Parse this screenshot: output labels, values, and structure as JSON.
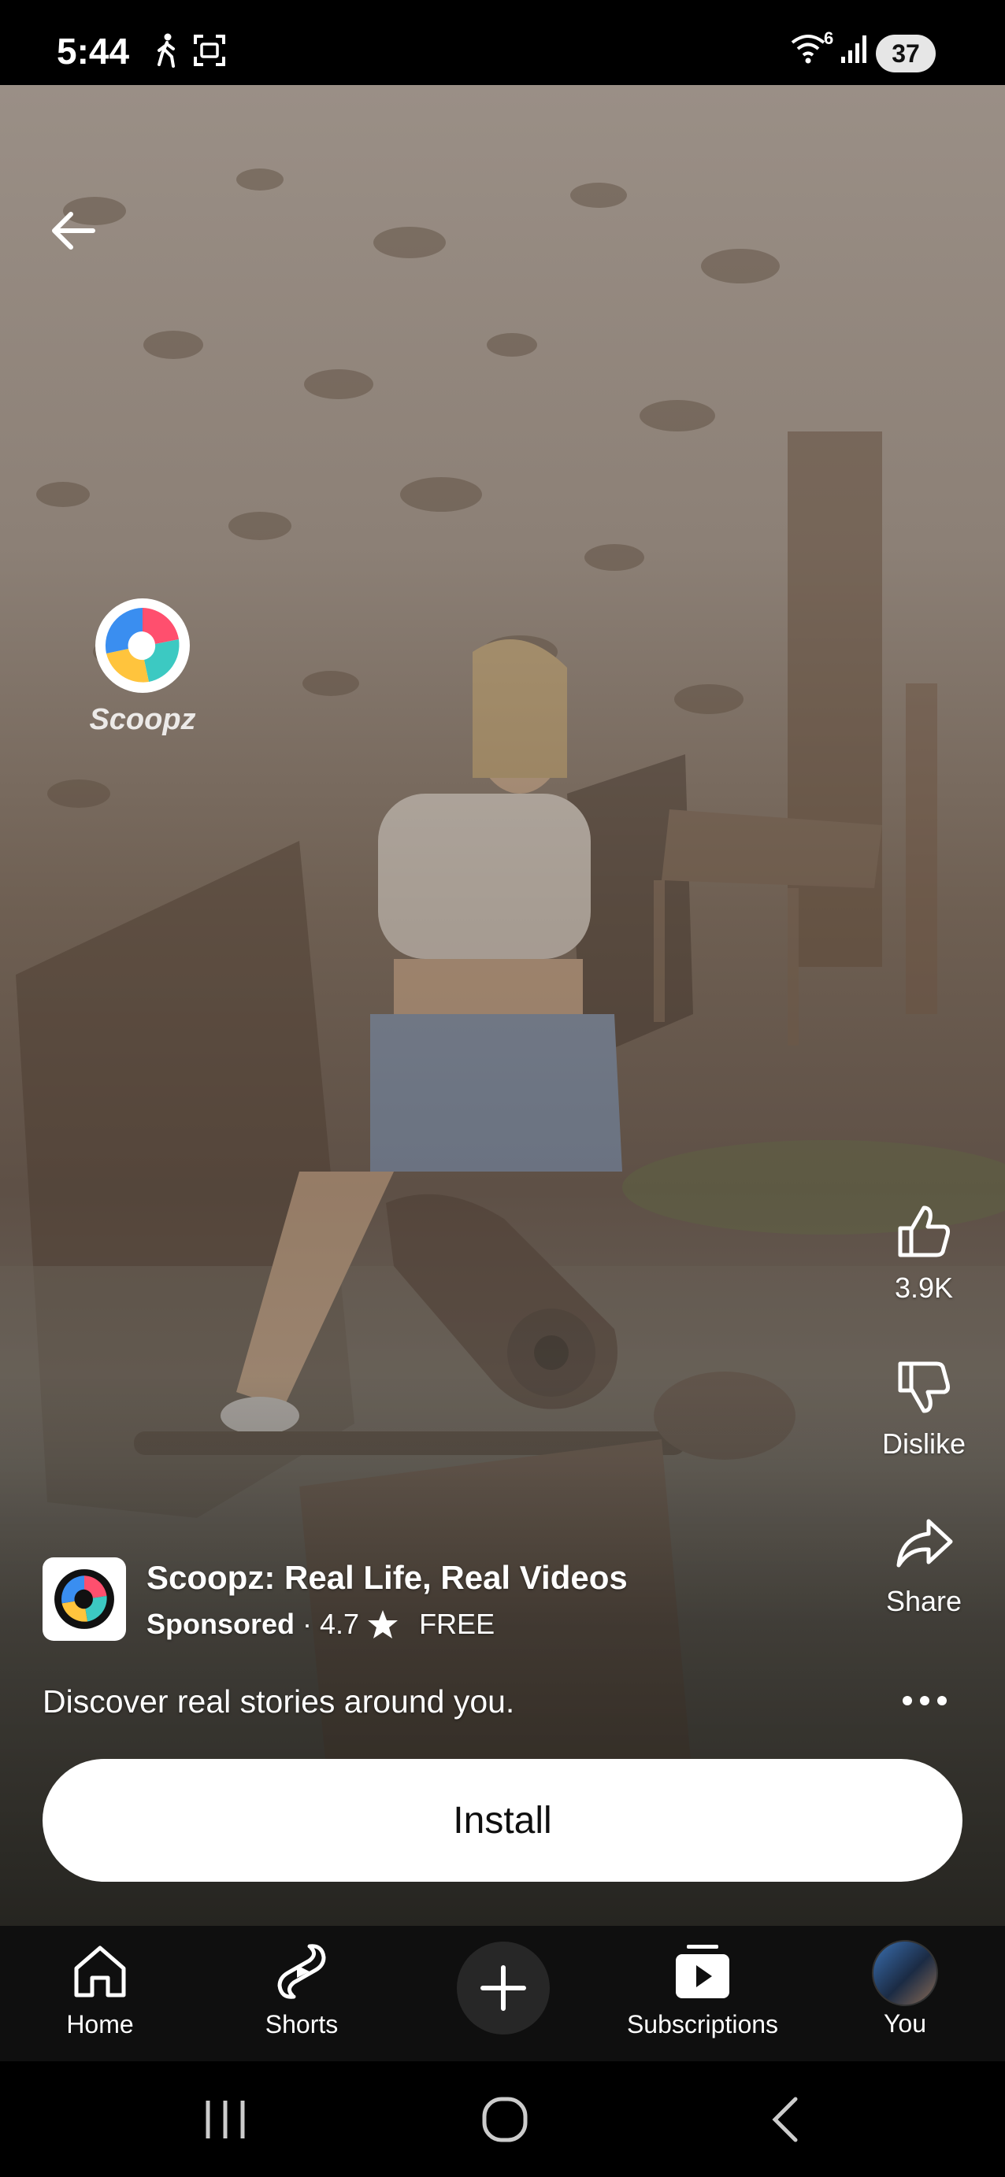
{
  "status_bar": {
    "time": "5:44",
    "icons": [
      "walking-icon",
      "screenshot-icon",
      "wifi-icon",
      "signal-icon"
    ],
    "wifi_badge": "6",
    "battery": "37"
  },
  "video": {
    "watermark_label": "Scoopz"
  },
  "actions": {
    "like_count": "3.9K",
    "dislike_label": "Dislike",
    "share_label": "Share"
  },
  "ad": {
    "title": "Scoopz: Real Life, Real Videos",
    "sponsored": "Sponsored",
    "separator": "·",
    "rating": "4.7",
    "price": "FREE",
    "description": "Discover real stories around you.",
    "install_label": "Install"
  },
  "nav": {
    "home": "Home",
    "shorts": "Shorts",
    "subscriptions": "Subscriptions",
    "you": "You"
  },
  "colors": {
    "nav_bg": "#0f0f0f",
    "button_bg": "#ffffff",
    "plus_bg": "#272727"
  }
}
